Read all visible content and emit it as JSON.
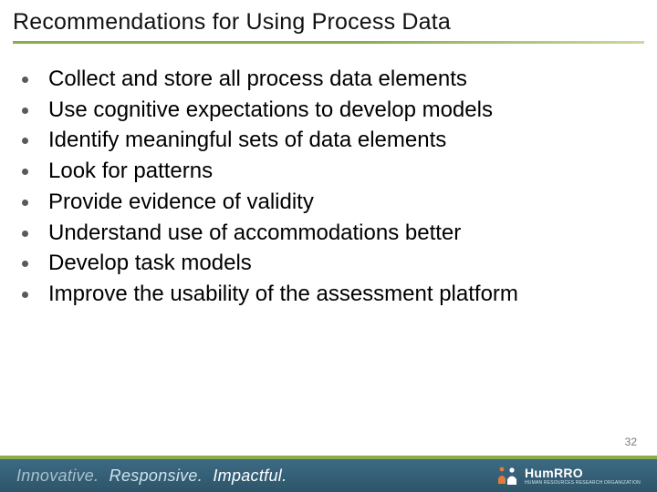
{
  "title": "Recommendations for Using Process Data",
  "bullets": [
    "Collect and store all process data elements",
    "Use cognitive expectations to develop models",
    "Identify meaningful sets of data elements",
    "Look for patterns",
    "Provide evidence of validity",
    "Understand use of accommodations better",
    "Develop task models",
    "Improve the usability of the assessment platform"
  ],
  "page_number": "32",
  "footer": {
    "tagline_w1": "Innovative.",
    "tagline_w2": "Responsive.",
    "tagline_w3": "Impactful.",
    "logo_name": "HumRRO",
    "logo_sub": "HUMAN RESOURCES RESEARCH ORGANIZATION"
  }
}
